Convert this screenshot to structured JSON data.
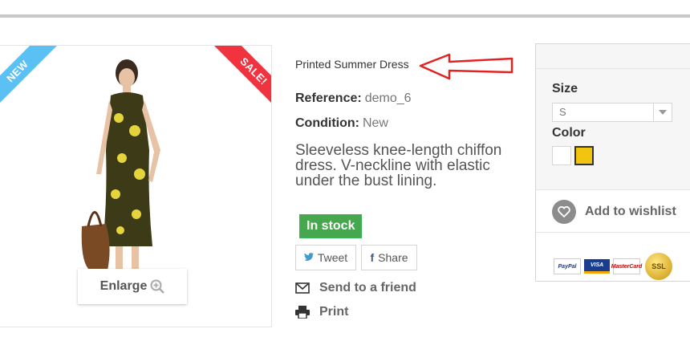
{
  "badges": {
    "new": "NEW",
    "sale": "SALE!"
  },
  "image": {
    "enlarge_label": "Enlarge"
  },
  "product": {
    "name": "Printed Summer Dress",
    "reference_label": "Reference:",
    "reference_value": "demo_6",
    "condition_label": "Condition:",
    "condition_value": "New",
    "description": "Sleeveless knee-length chiffon dress. V-neckline with elastic under the bust lining.",
    "stock": "In stock"
  },
  "share": {
    "tweet": "Tweet",
    "facebook": "Share"
  },
  "actions": {
    "send": "Send to a friend",
    "print": "Print"
  },
  "options": {
    "size_label": "Size",
    "size_selected": "S",
    "color_label": "Color",
    "colors": [
      "#ffffff",
      "#f1c40f"
    ]
  },
  "wishlist": {
    "label": "Add to wishlist"
  },
  "payment": {
    "paypal": "PayPal",
    "visa": "VISA",
    "mastercard": "MasterCard",
    "ssl": "SSL"
  },
  "colors": {
    "arrow": "#e32222",
    "new": "#5bc0f4",
    "sale": "#f13340",
    "stock": "#46a74e"
  }
}
